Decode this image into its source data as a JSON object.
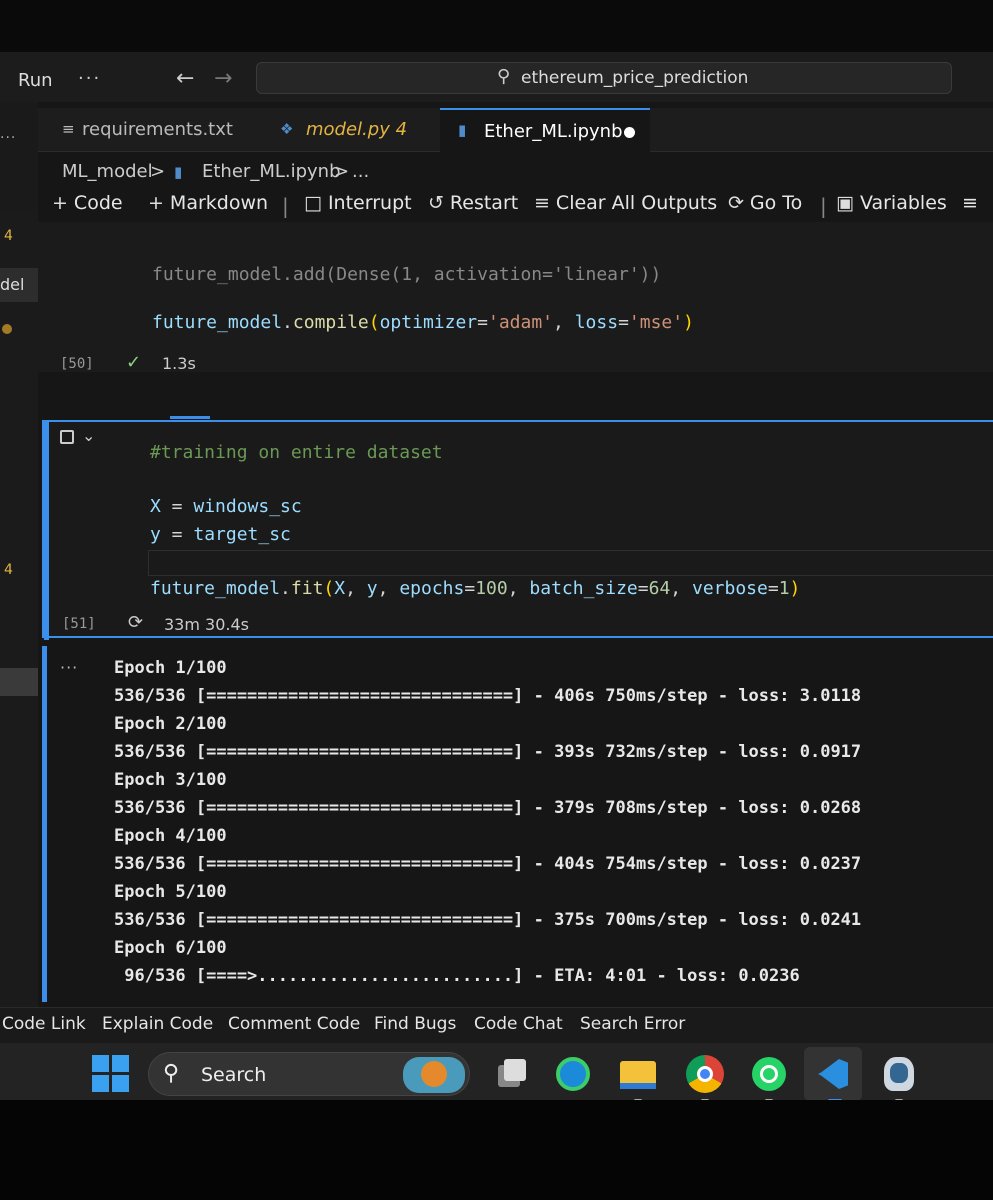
{
  "titlebar": {
    "run_menu": "Run",
    "more": "···",
    "back": "←",
    "forward": "→",
    "search_text": "ethereum_price_prediction"
  },
  "explorer": {
    "badge_top": "4",
    "selected_label": "del",
    "badge_bottom": "4"
  },
  "tabs": [
    {
      "label": "requirements.txt"
    },
    {
      "label": "model.py 4"
    },
    {
      "label": "Ether_ML.ipynb"
    }
  ],
  "breadcrumb": {
    "folder": "ML_model",
    "sep1": ">",
    "file": "Ether_ML.ipynb",
    "sep2": ">",
    "more": "..."
  },
  "toolbar": {
    "add_code": "Code",
    "add_markdown": "Markdown",
    "interrupt": "Interrupt",
    "restart": "Restart",
    "clear_outputs": "Clear All Outputs",
    "go_to": "Go To",
    "variables": "Variables"
  },
  "cell50": {
    "clipped_line": "future_model.add(Dense(1, activation='linear'))",
    "exec_count": "[50]",
    "duration": "1.3s"
  },
  "cell51": {
    "comment": "#training on entire dataset",
    "exec_count": "[51]",
    "duration": "33m 30.4s"
  },
  "output": {
    "lines": [
      "Epoch 1/100",
      "536/536 [==============================] - 406s 750ms/step - loss: 3.0118",
      "Epoch 2/100",
      "536/536 [==============================] - 393s 732ms/step - loss: 0.0917",
      "Epoch 3/100",
      "536/536 [==============================] - 379s 708ms/step - loss: 0.0268",
      "Epoch 4/100",
      "536/536 [==============================] - 404s 754ms/step - loss: 0.0237",
      "Epoch 5/100",
      "536/536 [==============================] - 375s 700ms/step - loss: 0.0241",
      "Epoch 6/100",
      " 96/536 [====>.........................] - ETA: 4:01 - loss: 0.0236"
    ]
  },
  "copilot": {
    "items": [
      "Code Link",
      "Explain Code",
      "Comment Code",
      "Find Bugs",
      "Code Chat",
      "Search Error"
    ]
  },
  "taskbar": {
    "search_label": "Search"
  },
  "colors": {
    "accent": "#3b8eea",
    "warning": "#e3b341",
    "success": "#89d185"
  }
}
